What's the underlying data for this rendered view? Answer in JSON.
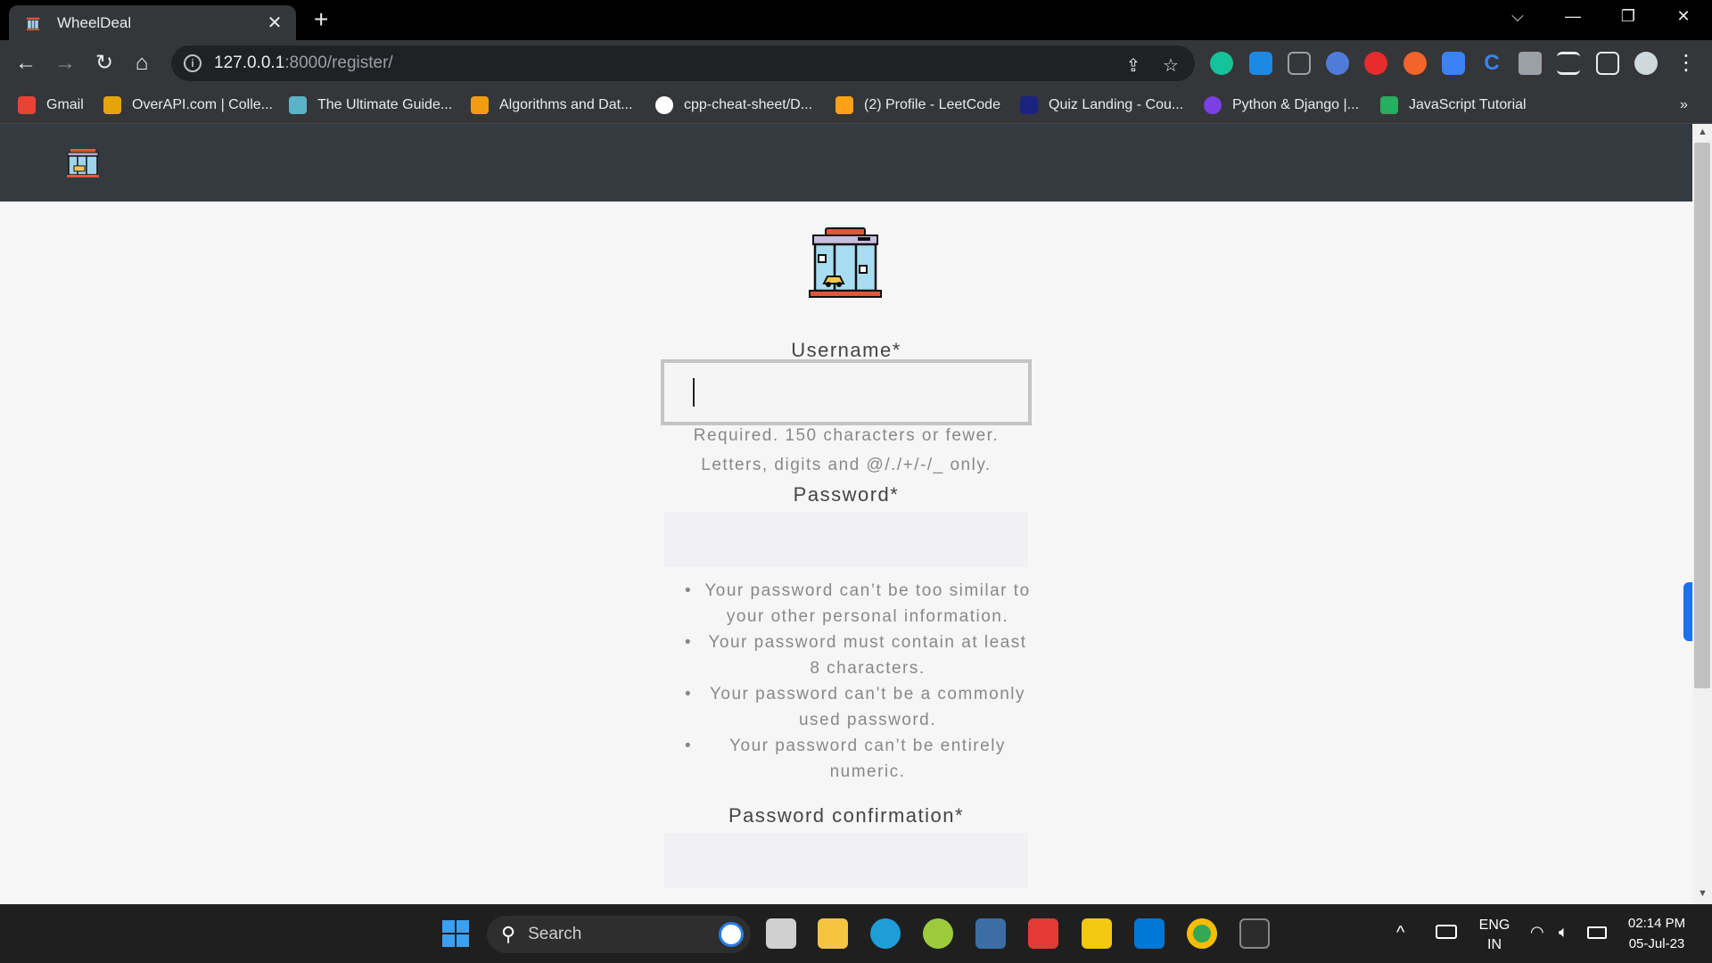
{
  "browser": {
    "tab_title": "WheelDeal",
    "tab_close": "✕",
    "new_tab": "+",
    "url_host": "127.0.0.1",
    "url_path": ":8000/register/",
    "window_controls": {
      "dropdown": "⌵",
      "minimize": "—",
      "restore": "❐",
      "close": "✕"
    },
    "nav": {
      "back": "←",
      "forward": "→",
      "reload": "↻",
      "home": "⌂"
    },
    "omnibox_icons": {
      "share": "⇪",
      "bookmark": "☆"
    },
    "menu": "⋮",
    "bookmarks": [
      {
        "label": "Gmail",
        "color": "#ea4335"
      },
      {
        "label": "OverAPI.com | Colle...",
        "color": "#e5a50a"
      },
      {
        "label": "The Ultimate Guide...",
        "color": "#5cb3c8"
      },
      {
        "label": "Algorithms and Dat...",
        "color": "#f39c12"
      },
      {
        "label": "cpp-cheat-sheet/D...",
        "color": "#ffffff"
      },
      {
        "label": "(2) Profile - LeetCode",
        "color": "#ffa116"
      },
      {
        "label": "Quiz Landing - Cou...",
        "color": "#1a237e"
      },
      {
        "label": "Python & Django |...",
        "color": "#7b3fe4"
      },
      {
        "label": "JavaScript Tutorial",
        "color": "#27ae60"
      }
    ],
    "bookmarks_more": "»"
  },
  "form": {
    "username_label": "Username*",
    "username_value": "",
    "username_help_1": "Required. 150 characters or fewer.",
    "username_help_2": "Letters, digits and @/./+/-/_ only.",
    "password_label": "Password*",
    "password_rules": [
      "Your password can’t be too similar to your other personal information.",
      "Your password must contain at least 8 characters.",
      "Your password can’t be a commonly used password.",
      "Your password can’t be entirely numeric."
    ],
    "password_confirmation_label": "Password confirmation*"
  },
  "taskbar": {
    "search_label": "Search",
    "lang_top": "ENG",
    "lang_bottom": "IN",
    "time": "02:14 PM",
    "date": "05-Jul-23",
    "tray_chevron": "^"
  },
  "colors": {
    "nav_bg": "#343a40",
    "page_bg": "#f6f6f7",
    "accent": "#1a73e8"
  }
}
